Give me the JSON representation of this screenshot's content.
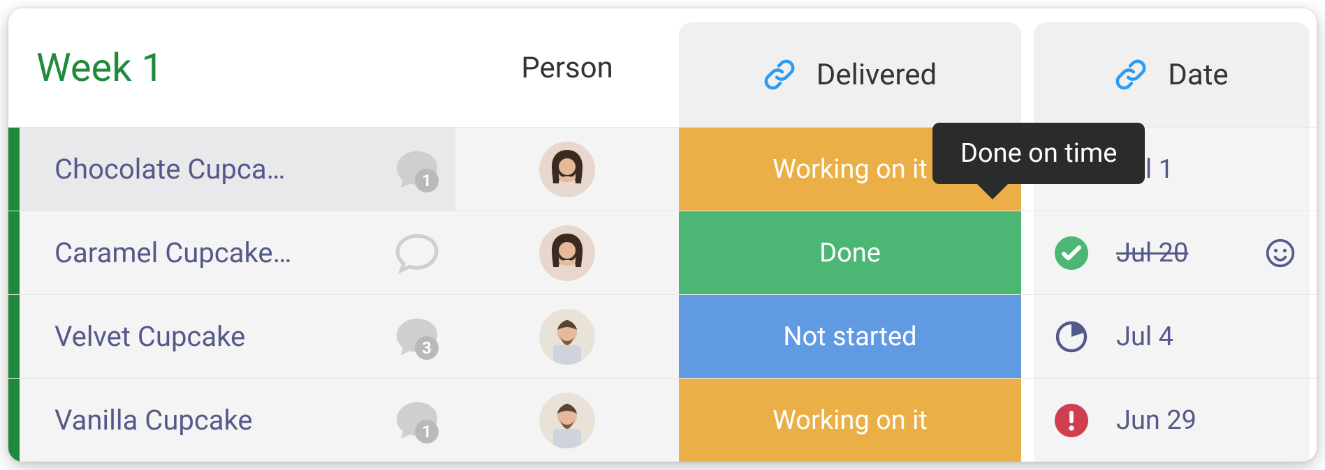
{
  "group_title": "Week 1",
  "columns": {
    "person": "Person",
    "delivered": "Delivered",
    "date": "Date"
  },
  "tooltip": "Done on time",
  "status_colors": {
    "Working on it": "#eab047",
    "Done": "#4cb774",
    "Not started": "#5f9ae3"
  },
  "rows": [
    {
      "name": "Chocolate Cupca…",
      "selected": true,
      "chat_count": "1",
      "avatar": "fем1",
      "status": "Working on it",
      "date": "Jul 1",
      "date_icon": "none",
      "struck": false,
      "smiley": false
    },
    {
      "name": "Caramel Cupcake…",
      "selected": false,
      "chat_count": "",
      "avatar": "fем1",
      "status": "Done",
      "date": "Jul 20",
      "date_icon": "check",
      "struck": true,
      "smiley": true
    },
    {
      "name": "Velvet Cupcake",
      "selected": false,
      "chat_count": "3",
      "avatar": "male1",
      "status": "Not started",
      "date": "Jul 4",
      "date_icon": "clock",
      "struck": false,
      "smiley": false
    },
    {
      "name": "Vanilla Cupcake",
      "selected": false,
      "chat_count": "1",
      "avatar": "male1",
      "status": "Working on it",
      "date": "Jun 29",
      "date_icon": "alert",
      "struck": false,
      "smiley": false
    }
  ]
}
